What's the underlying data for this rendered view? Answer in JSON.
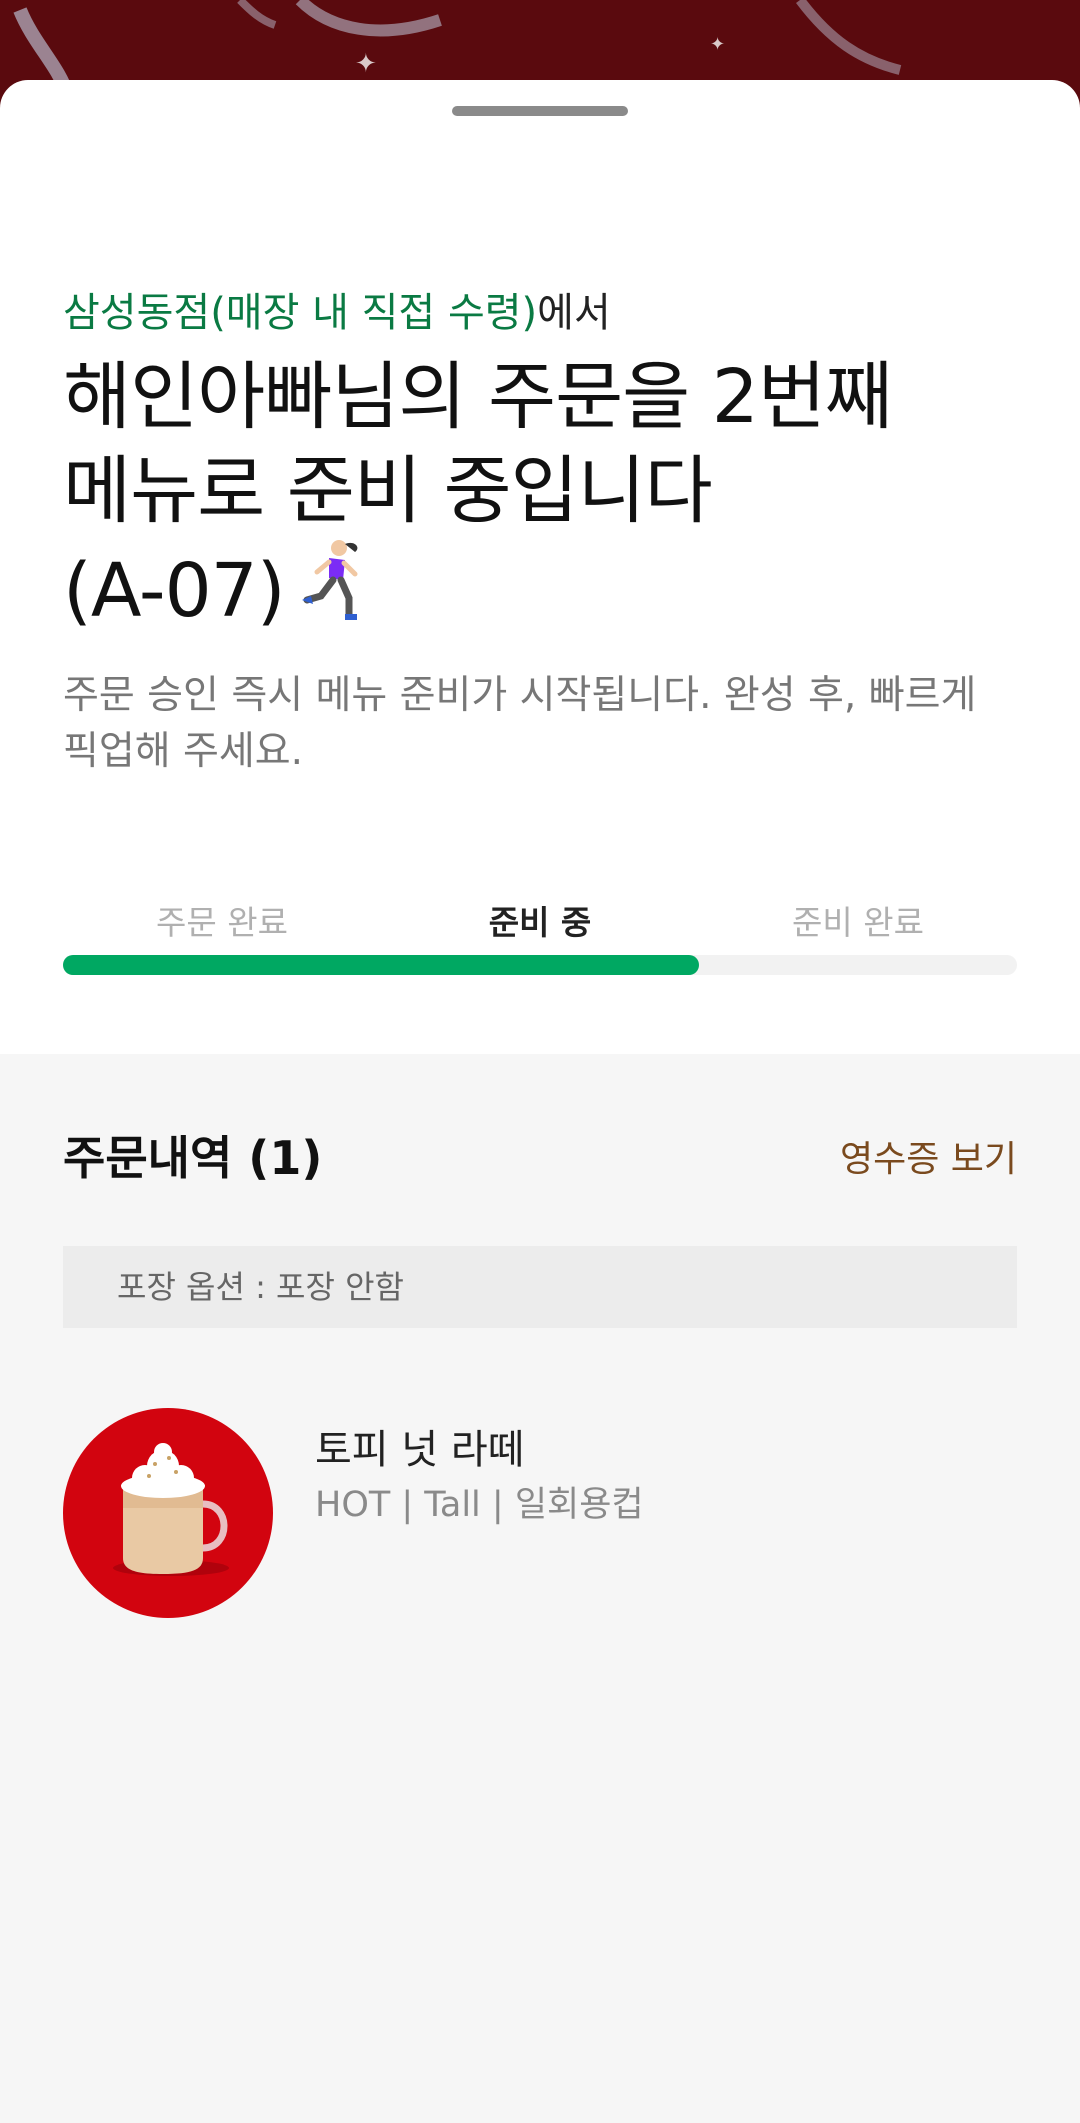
{
  "status": {
    "store_name": "삼성동점(매장 내 직접 수령)",
    "store_suffix": "에서",
    "headline_line1": "해인아빠님의 주문을 2번째",
    "headline_line2": "메뉴로 준비 중입니다",
    "order_code": "(A-07)",
    "runner_icon": "running-woman-emoji",
    "description": "주문 승인 즉시 메뉴 준비가 시작됩니다. 완성 후, 빠르게 픽업해 주세요."
  },
  "steps": {
    "items": [
      "주문 완료",
      "준비 중",
      "준비 완료"
    ],
    "active_index": 1,
    "progress_percent": 66.7
  },
  "order_history": {
    "title": "주문내역 (1)",
    "receipt_link": "영수증 보기",
    "packaging": "포장 옵션 : 포장 안함",
    "items": [
      {
        "name": "토피 넛 라떼",
        "options": "HOT | Tall | 일회용컵",
        "image_icon": "toffee-nut-latte-mug"
      }
    ]
  },
  "colors": {
    "brand_green": "#00a862",
    "store_green": "#0a7a43",
    "banner_red": "#5a0a0e",
    "item_bg_red": "#d2040f",
    "link_brown": "#7a4a1e"
  }
}
